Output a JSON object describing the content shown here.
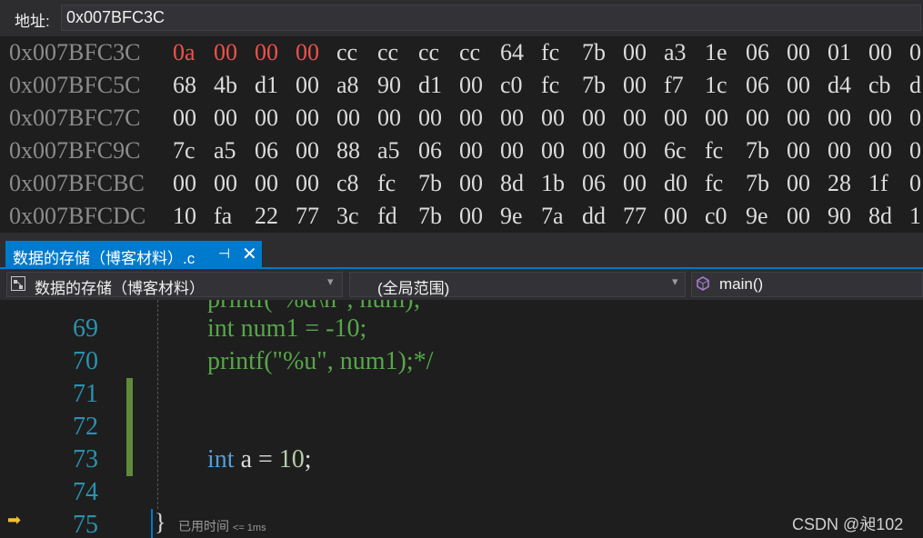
{
  "address_bar": {
    "label": "地址:",
    "value": "0x007BFC3C"
  },
  "memory": {
    "rows": [
      {
        "addr": "0x007BFC3C",
        "bytes": [
          "0a",
          "00",
          "00",
          "00",
          "cc",
          "cc",
          "cc",
          "cc",
          "64",
          "fc",
          "7b",
          "00",
          "a3",
          "1e",
          "06",
          "00",
          "01",
          "00",
          "0"
        ],
        "changed_count": 4
      },
      {
        "addr": "0x007BFC5C",
        "bytes": [
          "68",
          "4b",
          "d1",
          "00",
          "a8",
          "90",
          "d1",
          "00",
          "c0",
          "fc",
          "7b",
          "00",
          "f7",
          "1c",
          "06",
          "00",
          "d4",
          "cb",
          "d"
        ],
        "changed_count": 0
      },
      {
        "addr": "0x007BFC7C",
        "bytes": [
          "00",
          "00",
          "00",
          "00",
          "00",
          "00",
          "00",
          "00",
          "00",
          "00",
          "00",
          "00",
          "00",
          "00",
          "00",
          "00",
          "00",
          "00",
          "0"
        ],
        "changed_count": 0
      },
      {
        "addr": "0x007BFC9C",
        "bytes": [
          "7c",
          "a5",
          "06",
          "00",
          "88",
          "a5",
          "06",
          "00",
          "00",
          "00",
          "00",
          "00",
          "6c",
          "fc",
          "7b",
          "00",
          "00",
          "00",
          "0"
        ],
        "changed_count": 0
      },
      {
        "addr": "0x007BFCBC",
        "bytes": [
          "00",
          "00",
          "00",
          "00",
          "c8",
          "fc",
          "7b",
          "00",
          "8d",
          "1b",
          "06",
          "00",
          "d0",
          "fc",
          "7b",
          "00",
          "28",
          "1f",
          "0"
        ],
        "changed_count": 0
      },
      {
        "addr": "0x007BFCDC",
        "bytes": [
          "10",
          "fa",
          "22",
          "77",
          "3c",
          "fd",
          "7b",
          "00",
          "9e",
          "7a",
          "dd",
          "77",
          "00",
          "c0",
          "9e",
          "00",
          "90",
          "8d",
          "1"
        ],
        "changed_count": 0
      }
    ]
  },
  "tab": {
    "label": "数据的存储（博客材料）.c",
    "pin": "⊣",
    "close": "✕"
  },
  "nav": {
    "file_scope": "数据的存储（博客材料）",
    "global_scope": "(全局范围)",
    "function": "main()"
  },
  "editor": {
    "partial_line": "printf(\"%d\\n\", num);",
    "line_numbers": [
      "69",
      "70",
      "71",
      "72",
      "73",
      "74",
      "75"
    ],
    "lines": {
      "l69_kw": "int",
      "l69_rest": " num1 = -10;",
      "l70": "printf(\"%u\", num1);*/",
      "l73_kw": "int",
      "l73_var": " a = ",
      "l73_num": "10",
      "l73_end": ";"
    },
    "brace": "}",
    "elapsed_label": "已用时间",
    "elapsed_value": "<= 1ms"
  },
  "watermark": "CSDN @昶102",
  "colors": {
    "accent": "#007acc",
    "changed_byte": "#f0514c",
    "line_number": "#2b91af",
    "comment": "#57a64a",
    "keyword": "#569cd6"
  },
  "icons": [
    "current-statement-arrow-icon",
    "file-scope-icon",
    "function-cube-icon",
    "pin-icon",
    "close-icon",
    "dropdown-arrow-icon"
  ]
}
